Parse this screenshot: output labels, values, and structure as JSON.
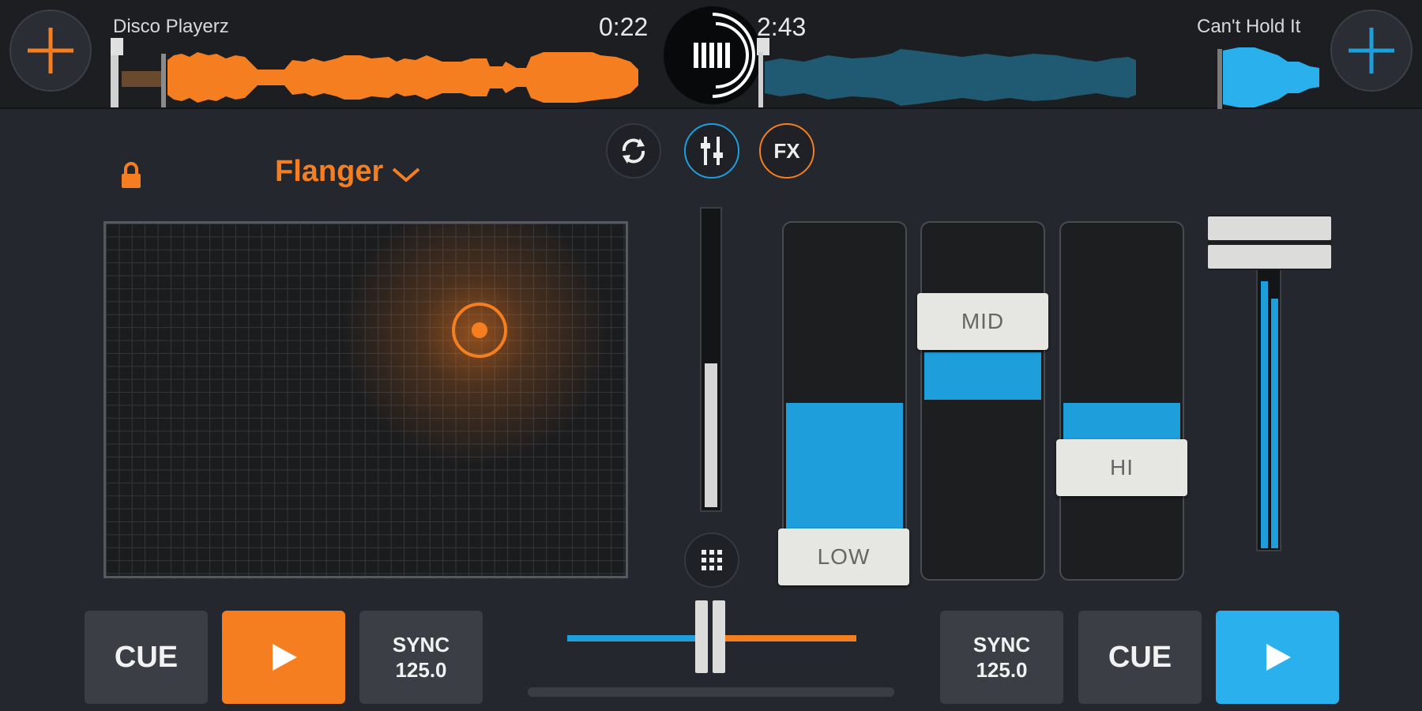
{
  "deck_left": {
    "track_title": "Disco Playerz",
    "elapsed_time": "0:22",
    "accent_color": "#f57f20",
    "add_icon": "plus-icon"
  },
  "deck_right": {
    "track_title": "Can't Hold It",
    "remaining_time": "2:43",
    "accent_color": "#1e9fdc",
    "add_icon": "plus-icon"
  },
  "center": {
    "logo_icon": "app-logo-icon",
    "mode_buttons": [
      "sync-loop-icon",
      "mixer-sliders-icon",
      "fx-icon"
    ],
    "fx_label": "FX",
    "grid_icon": "grid-icon"
  },
  "fx_panel": {
    "effect_name": "Flanger",
    "lock_icon": "lock-icon",
    "dropdown_icon": "chevron-down-icon"
  },
  "eq": {
    "low_label": "LOW",
    "mid_label": "MID",
    "hi_label": "HI"
  },
  "transport_left": {
    "cue_label": "CUE",
    "play_icon": "play-icon",
    "sync_label": "SYNC",
    "bpm": "125.0"
  },
  "transport_right": {
    "sync_label": "SYNC",
    "bpm": "125.0",
    "cue_label": "CUE",
    "play_icon": "play-icon"
  }
}
